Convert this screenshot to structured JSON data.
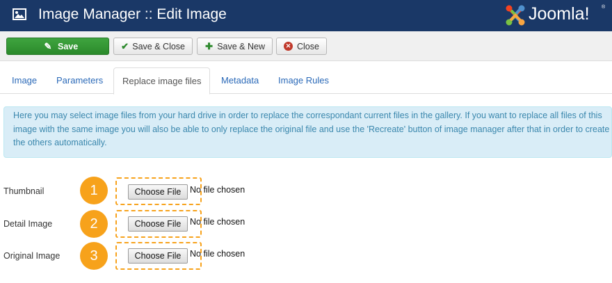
{
  "window": {
    "title": "Image Manager :: Edit Image",
    "logo_text": "Joomla!",
    "logo_reg": "®"
  },
  "toolbar": {
    "save_label": "Save",
    "save_close_label": "Save & Close",
    "save_new_label": "Save & New",
    "close_label": "Close"
  },
  "tabs": [
    {
      "label": "Image",
      "active": false
    },
    {
      "label": "Parameters",
      "active": false
    },
    {
      "label": "Replace image files",
      "active": true
    },
    {
      "label": "Metadata",
      "active": false
    },
    {
      "label": "Image Rules",
      "active": false
    }
  ],
  "info": {
    "text": "Here you may select image files from your hard drive in order to replace the correspondant current files in the gallery. If you want to replace all files of this image with the same image you will also be able to only replace the original file and use the 'Recreate' button of image manager after that in order to create the others automatically."
  },
  "fields": [
    {
      "label": "Thumbnail",
      "badge": "1",
      "button": "Choose File",
      "status": "No file chosen"
    },
    {
      "label": "Detail Image",
      "badge": "2",
      "button": "Choose File",
      "status": "No file chosen"
    },
    {
      "label": "Original Image",
      "badge": "3",
      "button": "Choose File",
      "status": "No file chosen"
    }
  ],
  "colors": {
    "header": "#1a3867",
    "save_green": "#3fa43f",
    "info_bg": "#d9edf7",
    "info_text": "#3a87ad",
    "badge_orange": "#f7a21b",
    "link_blue": "#2a69b8"
  },
  "icons": {
    "title": "image-icon",
    "save": "edit-icon",
    "save_close": "check-icon",
    "save_new": "plus-icon",
    "close": "close-circle-icon",
    "logo": "joomla-logo-icon"
  }
}
